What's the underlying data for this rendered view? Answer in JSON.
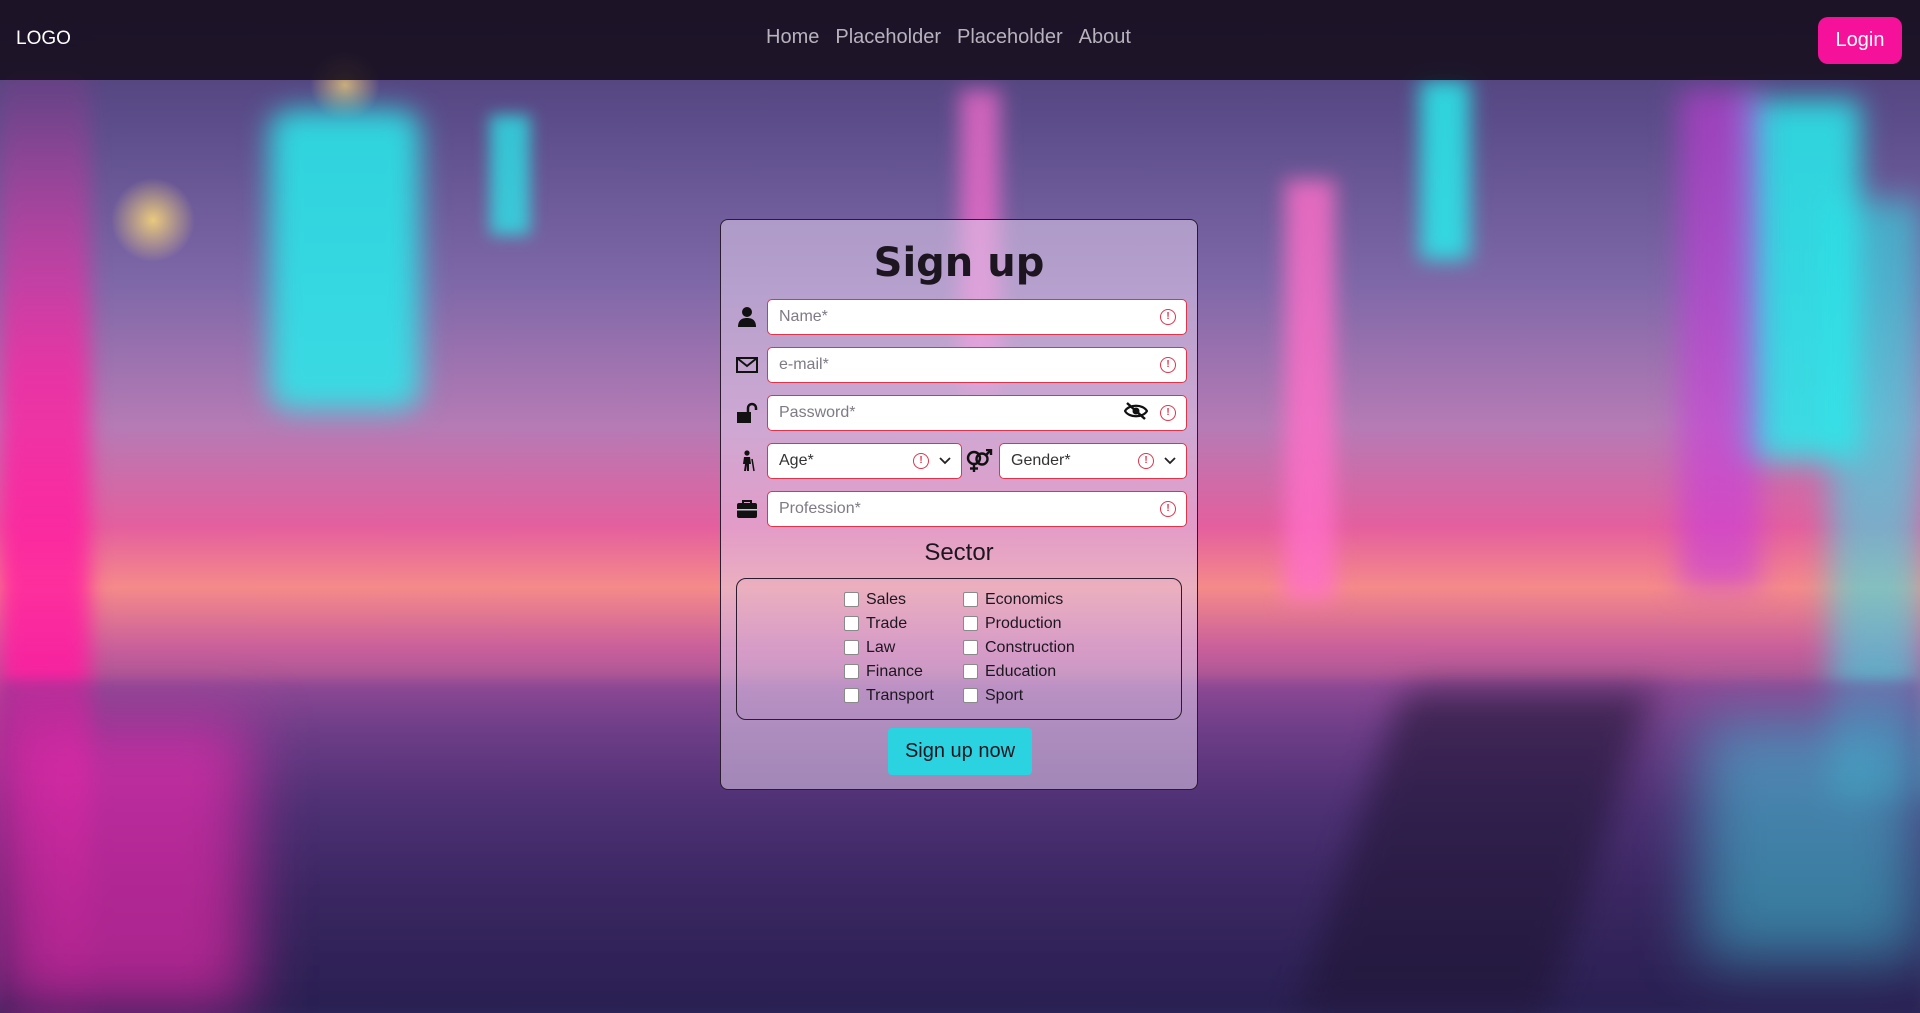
{
  "nav": {
    "logo": "LOGO",
    "links": [
      "Home",
      "Placeholder",
      "Placeholder",
      "About"
    ],
    "login_label": "Login"
  },
  "form": {
    "title": "Sign up",
    "name_placeholder": "Name*",
    "email_placeholder": "e-mail*",
    "password_placeholder": "Password*",
    "age_selected": "Age*",
    "gender_selected": "Gender*",
    "profession_placeholder": "Profession*",
    "sector_title": "Sector",
    "sectors_left": [
      "Sales",
      "Trade",
      "Law",
      "Finance",
      "Transport"
    ],
    "sectors_right": [
      "Economics",
      "Production",
      "Construction",
      "Education",
      "Sport"
    ],
    "submit_label": "Sign up now"
  },
  "colors": {
    "accent_pink": "#f5119a",
    "accent_cyan": "#2bd3e0",
    "error_red": "#e0344b"
  },
  "icons": [
    "user-icon",
    "envelope-icon",
    "unlock-icon",
    "person-walking-icon",
    "gender-icon",
    "briefcase-icon",
    "eye-slash-icon",
    "exclamation-circle-icon",
    "chevron-down-icon"
  ]
}
